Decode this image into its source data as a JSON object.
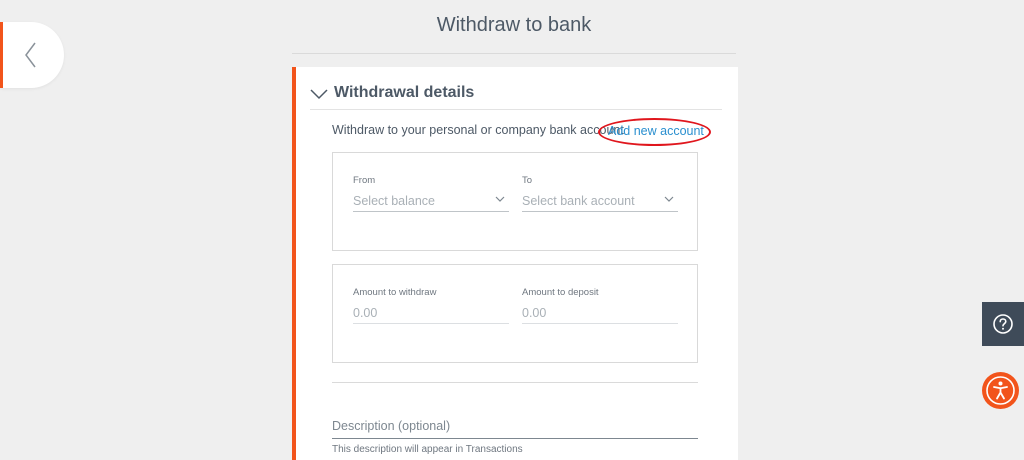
{
  "header": {
    "title": "Withdraw to bank",
    "back_icon": "chevron-left-icon"
  },
  "card": {
    "title": "Withdrawal details",
    "collapse_icon": "chevron-down-icon",
    "intro": "Withdraw to your personal or company bank account",
    "add_account_link": "Add new account",
    "from": {
      "label": "From",
      "placeholder": "Select balance"
    },
    "to": {
      "label": "To",
      "placeholder": "Select bank account"
    },
    "amount_withdraw": {
      "label": "Amount to withdraw",
      "value": "0.00"
    },
    "amount_deposit": {
      "label": "Amount to deposit",
      "value": "0.00"
    },
    "description": {
      "placeholder": "Description (optional)",
      "help": "This description will appear in Transactions"
    }
  },
  "widgets": {
    "help_icon": "question-icon",
    "accessibility_icon": "accessibility-icon"
  },
  "colors": {
    "accent": "#f2541b",
    "link": "#2a8fcf",
    "highlight_ring": "#e0161d",
    "help_bg": "#3f4b59"
  }
}
